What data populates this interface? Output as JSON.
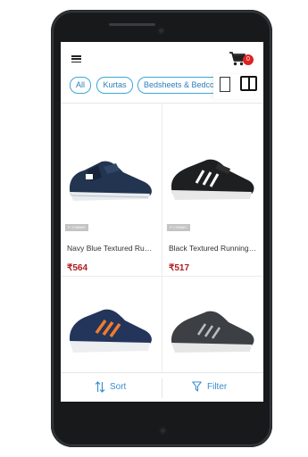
{
  "header": {
    "menu_icon": "hamburger-menu-icon",
    "cart_icon": "shopping-cart-icon",
    "cart_count": "0"
  },
  "categories": [
    "All",
    "Kurtas",
    "Bedsheets & Bedcovers"
  ],
  "view_toggle": {
    "single_icon": "single-column-view-icon",
    "grid_icon": "grid-view-icon"
  },
  "products": [
    {
      "tag": "P-1766865",
      "name": "Navy Blue Textured Running Shoes",
      "price": "₹564",
      "color": "#22344f"
    },
    {
      "tag": "P-1766867",
      "name": "Black Textured Running Shoes",
      "price": "₹517",
      "color": "#1e1f20"
    },
    {
      "tag": "",
      "name": "",
      "price": "",
      "color": "#23355a"
    },
    {
      "tag": "",
      "name": "",
      "price": "",
      "color": "#3c3f43"
    }
  ],
  "bottom_bar": {
    "sort_label": "Sort",
    "filter_label": "Filter",
    "sort_icon": "sort-arrows-icon",
    "filter_icon": "filter-funnel-icon",
    "accent": "#3a8fd0"
  },
  "colors": {
    "price": "#b01e1e",
    "chip_border": "#3aa8d8",
    "badge": "#e02222"
  }
}
